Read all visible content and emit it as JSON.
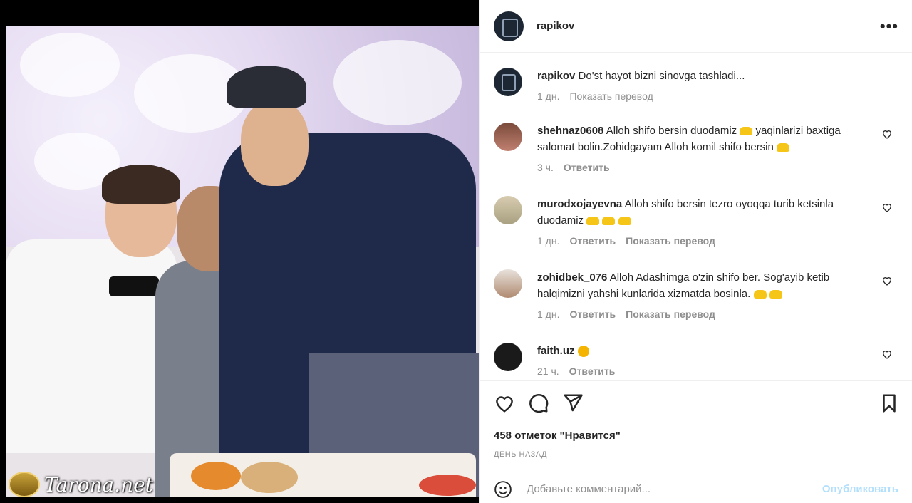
{
  "post": {
    "author": "rapikov",
    "more_icon": "more-icon",
    "caption": {
      "user": "rapikov",
      "text": "Do'st hayot bizni sinovga tashladi...",
      "time": "1 дн.",
      "translate": "Показать перевод"
    }
  },
  "comments": [
    {
      "user": "shehnaz0608",
      "text": "Alloh shifo bersin duodamiz",
      "text2": "yaqinlarizi baxtiga salomat bolin.Zohidgayam Alloh komil shifo bersin",
      "time": "3 ч.",
      "reply": "Ответить",
      "translate": ""
    },
    {
      "user": "murodxojayevna",
      "text": "Alloh shifo bersin tezro oyoqqa turib ketsinla duodamiz",
      "time": "1 дн.",
      "reply": "Ответить",
      "translate": "Показать перевод"
    },
    {
      "user": "zohidbek_076",
      "text": "Alloh Adashimga o'zin shifo ber. Sog'ayib ketib halqimizni yahshi kunlarida xizmatda bosinla.",
      "time": "1 дн.",
      "reply": "Ответить",
      "translate": "Показать перевод"
    },
    {
      "user": "faith.uz",
      "text": "",
      "time": "21 ч.",
      "reply": "Ответить",
      "translate": ""
    }
  ],
  "likes": "458 отметок \"Нравится\"",
  "posted": "ДЕНЬ НАЗАД",
  "add_comment": {
    "placeholder": "Добавьте комментарий...",
    "post": "Опубликовать"
  },
  "watermark": "Tarona.net",
  "colors": {
    "link": "#0095f6",
    "post_disabled": "#b2dffc",
    "muted": "#8e8e8e"
  }
}
